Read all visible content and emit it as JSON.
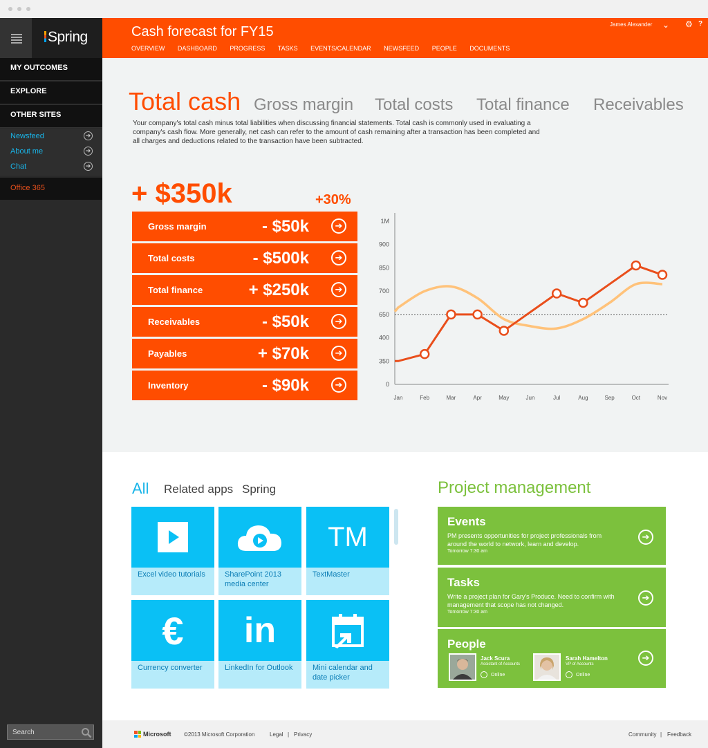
{
  "sidebar": {
    "logo": "Spring",
    "items": [
      "MY OUTCOMES",
      "EXPLORE",
      "OTHER SITES"
    ],
    "sub_items": [
      "Newsfeed",
      "About me",
      "Chat"
    ],
    "office": "Office 365",
    "search_placeholder": "Search"
  },
  "header": {
    "title": "Cash forecast for FY15",
    "nav": [
      "OVERVIEW",
      "DASHBOARD",
      "PROGRESS",
      "TASKS",
      "EVENTS/CALENDAR",
      "NEWSFEED",
      "PEOPLE",
      "DOCUMENTS"
    ],
    "user": "James Alexander"
  },
  "metrics_tabs": [
    "Total cash",
    "Gross margin",
    "Total costs",
    "Total finance",
    "Receivables"
  ],
  "description": "Your company's total cash minus total liabilities when discussing financial statements. Total cash is commonly used in evaluating a company's cash flow. More generally, net cash can refer to the amount of cash remaining after a transaction has been completed and all charges and deductions related to the transaction have been subtracted.",
  "summary": {
    "total": "+ $350k",
    "change": "+30%"
  },
  "breakdown": [
    {
      "label": "Gross margin",
      "value": "- $50k"
    },
    {
      "label": "Total costs",
      "value": "- $500k"
    },
    {
      "label": "Total finance",
      "value": "+ $250k"
    },
    {
      "label": "Receivables",
      "value": "- $50k"
    },
    {
      "label": "Payables",
      "value": "+ $70k"
    },
    {
      "label": "Inventory",
      "value": "- $90k"
    }
  ],
  "chart_data": {
    "type": "line",
    "categories": [
      "Jan",
      "Feb",
      "Mar",
      "Apr",
      "May",
      "Jun",
      "Jul",
      "Aug",
      "Sep",
      "Oct",
      "Nov"
    ],
    "y_ticks": [
      "0",
      "350",
      "400",
      "650",
      "700",
      "850",
      "900",
      "1M"
    ],
    "series": [
      {
        "values": [
          1.0,
          1.3,
          3.0,
          3.0,
          2.3,
          null,
          3.9,
          3.5,
          null,
          5.1,
          4.7
        ],
        "color": "#e94e1b",
        "style": "solid-with-markers"
      },
      {
        "values": [
          3.3,
          4.0,
          4.2,
          3.7,
          2.8,
          2.5,
          2.4,
          2.8,
          3.5,
          4.3,
          4.3
        ],
        "color": "#ffc27a",
        "style": "smooth"
      }
    ],
    "reference_line": {
      "y": 3.0,
      "style": "dashed"
    },
    "ylim": [
      0,
      7
    ],
    "legend": "none",
    "grid": false
  },
  "apps": {
    "tabs": [
      "All",
      "Related apps",
      "Spring"
    ],
    "items": [
      {
        "label": "Excel video tutorials",
        "icon": "play-icon"
      },
      {
        "label": "SharePoint 2013 media center",
        "icon": "cloud-play-icon"
      },
      {
        "label": "TextMaster",
        "icon": "trademark-icon",
        "glyph": "TM"
      },
      {
        "label": "Currency converter",
        "icon": "euro-icon",
        "glyph": "€"
      },
      {
        "label": "LinkedIn for Outlook",
        "icon": "linkedin-icon",
        "glyph": "in"
      },
      {
        "label": "Mini calendar and date picker",
        "icon": "calendar-icon"
      }
    ]
  },
  "project_management": {
    "title": "Project management",
    "events": {
      "title": "Events",
      "text": "PM presents opportunities for project professionals from around the world to network, learn and develop.",
      "time": "Tomorrow 7:30 am"
    },
    "tasks": {
      "title": "Tasks",
      "text": "Write a project plan for Gary's Produce. Need to confirm with management that scope has not changed.",
      "time": "Tomorrow 7:30 am"
    },
    "people": {
      "title": "People",
      "members": [
        {
          "name": "Jack Scura",
          "role": "Assistant of Accounts",
          "status": "Online"
        },
        {
          "name": "Sarah Hamelton",
          "role": "VP of Accounts",
          "status": "Online"
        }
      ]
    }
  },
  "footer": {
    "brand": "Microsoft",
    "copyright": "©2013 Microsoft Corporation",
    "links": [
      "Legal",
      "Privacy"
    ],
    "right_links": [
      "Community",
      "Feedback"
    ]
  }
}
